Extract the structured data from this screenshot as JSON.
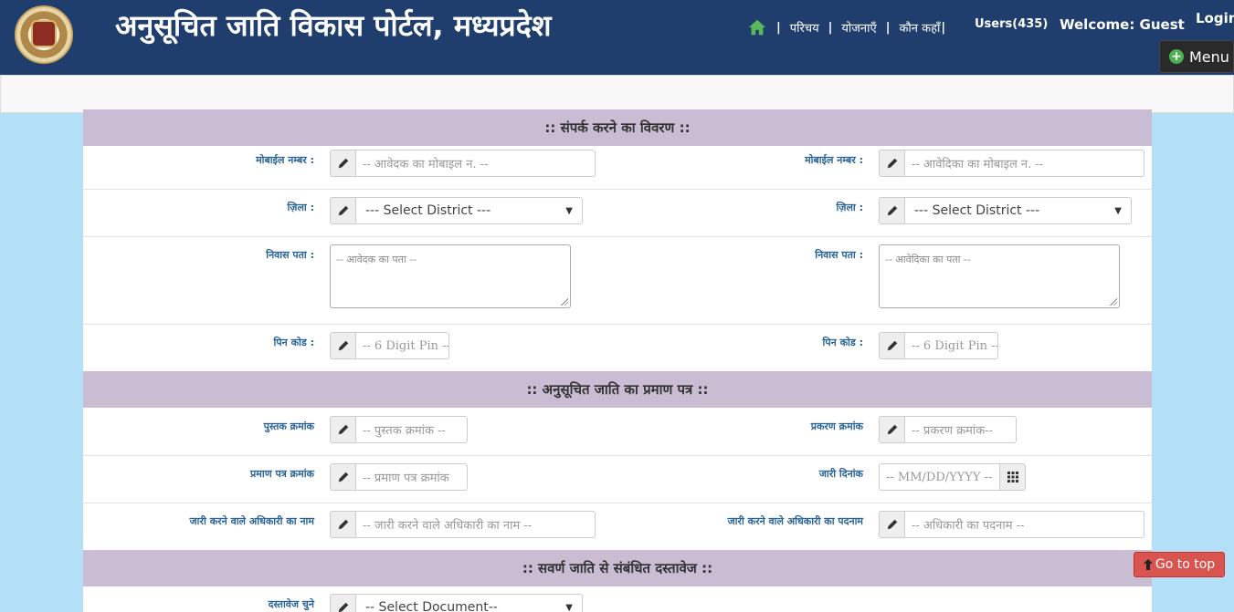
{
  "header": {
    "title": "अनुसूचित जाति विकास पोर्टल, मध्यप्रदेश",
    "nav": [
      "परिचय",
      "योजनाएँ",
      "कौन कहाँ"
    ],
    "users": "Users(435)",
    "welcome": "Welcome: Guest",
    "login": "Login",
    "menu": "Menu"
  },
  "sections": {
    "contact": ":: संपर्क करने का विवरण ::",
    "certificate": ":: अनुसूचित जाति का प्रमाण पत्र ::",
    "documents": ":: सवर्ण जाति से संबंधित दस्तावेज ::"
  },
  "contact": {
    "mobile_label": "मोबाईल नम्बर :",
    "mobile_applicant_placeholder": "-- आवेदक का मोबाइल न. --",
    "mobile_applicant2_placeholder": "-- आवेदिका का मोबाइल न. --",
    "district_label": "ज़िला :",
    "district_select": "--- Select District ---",
    "address_label": "निवास पता :",
    "address_applicant_placeholder": "-- आवेदक का पता --",
    "address_applicant2_placeholder": "-- आवेदिका का पता --",
    "pin_label": "पिन कोड :",
    "pin_placeholder": "-- 6 Digit Pin --"
  },
  "certificate": {
    "book_label": "पुस्तक क्रमांक",
    "book_placeholder": "-- पुस्तक क्रमांक --",
    "case_label": "प्रकरण क्रमांक",
    "case_placeholder": "-- प्रकरण क्रमांक--",
    "cert_label": "प्रमाण पत्र क्रमांक",
    "cert_placeholder": "-- प्रमाण पत्र क्रमांक",
    "issue_date_label": "जारी दिनांक",
    "issue_date_placeholder": "-- MM/DD/YYYY --",
    "officer_name_label": "जारी करने वाले अधिकारी का नाम",
    "officer_name_placeholder": "-- जारी करने वाले अधिकारी का नाम --",
    "officer_post_label": "जारी करने वाले अधिकारी का पदनाम",
    "officer_post_placeholder": "-- अधिकारी का पदनाम --"
  },
  "documents": {
    "choose_label": "दस्तावेज चुने",
    "choose_select": "-- Select Document--"
  },
  "goto_top": "Go to top",
  "colors": {
    "header_bg": "#1f3e6e",
    "section_bg": "#c9bcd3",
    "page_bg": "#b3e0f7",
    "label": "#2a6496",
    "goto_top_bg": "#d9534f"
  }
}
